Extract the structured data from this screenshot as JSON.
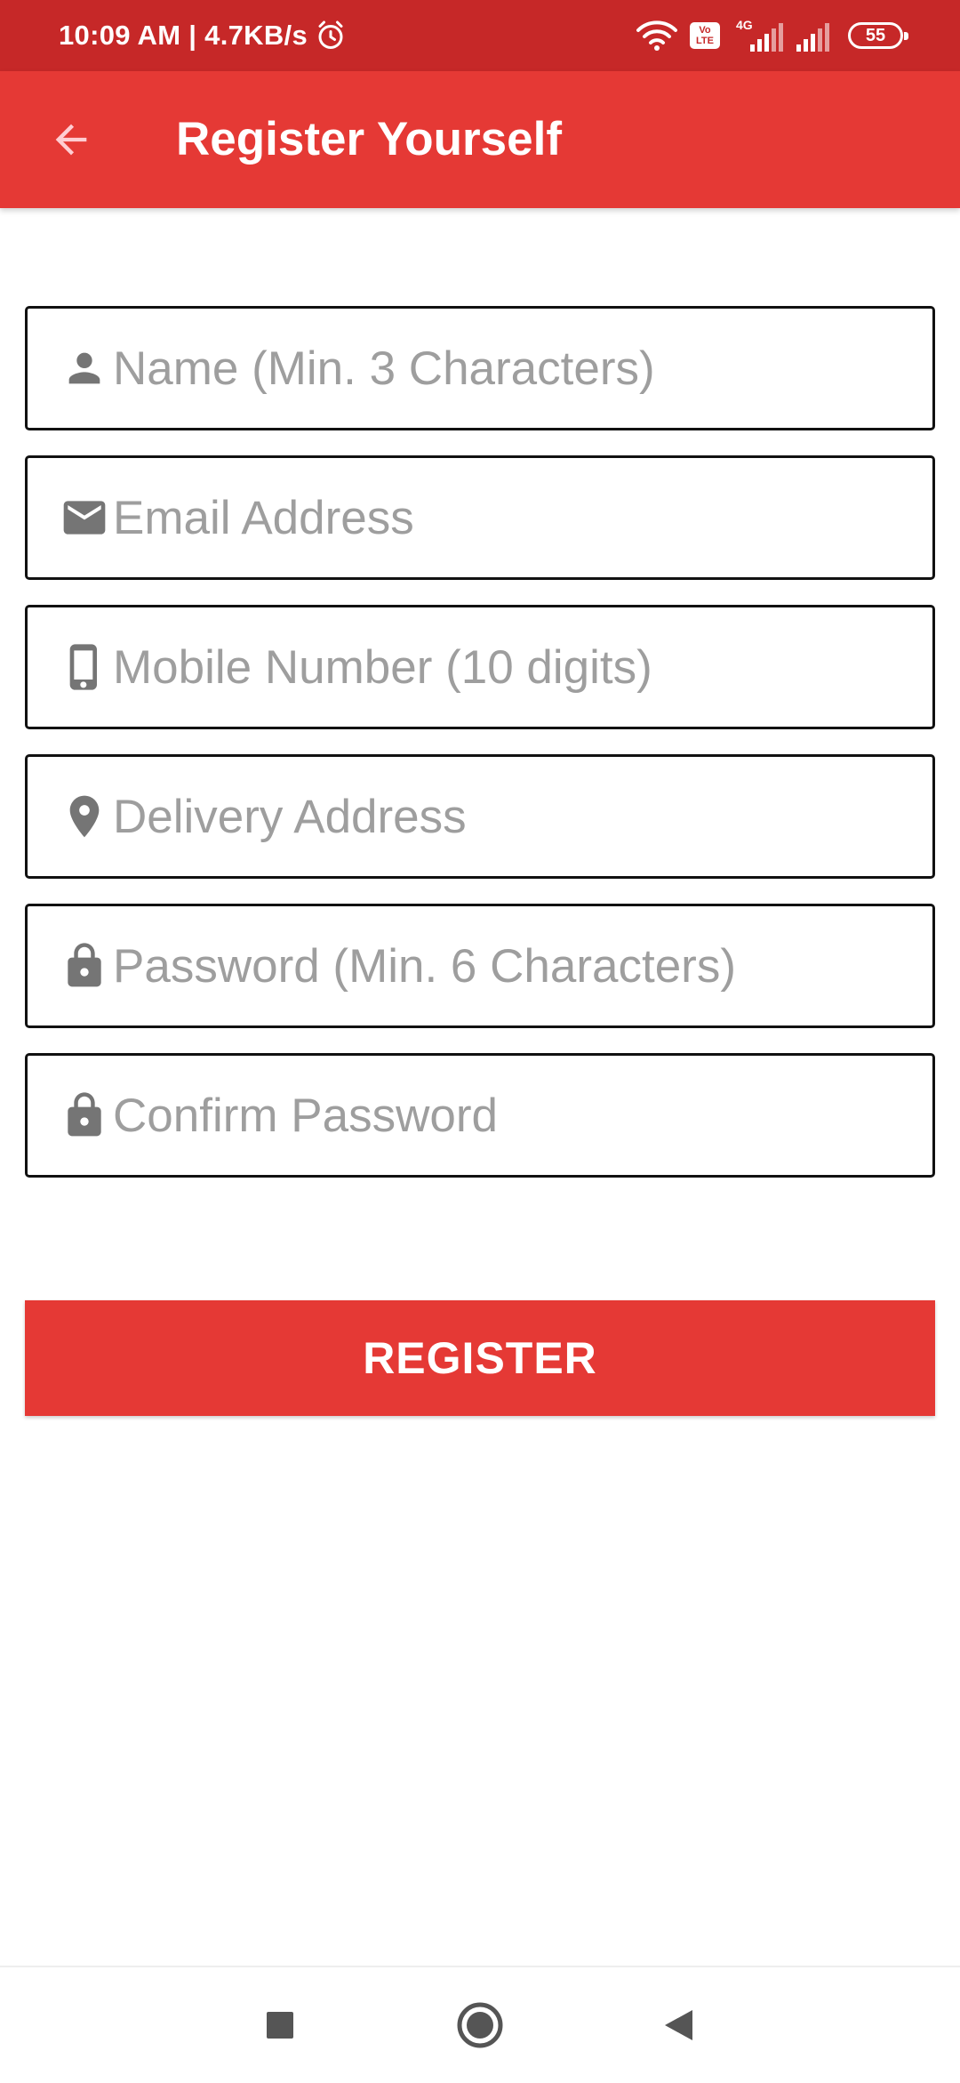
{
  "status_bar": {
    "time_speed": "10:09 AM | 4.7KB/s",
    "volte_line1": "Vo",
    "volte_line2": "LTE",
    "network_type": "4G",
    "battery": "55"
  },
  "app_bar": {
    "title": "Register Yourself",
    "background_color": "#e53935"
  },
  "form": {
    "fields": [
      {
        "icon": "person-icon",
        "placeholder": "Name (Min. 3 Characters)",
        "value": ""
      },
      {
        "icon": "email-icon",
        "placeholder": "Email Address",
        "value": ""
      },
      {
        "icon": "phone-icon",
        "placeholder": "Mobile Number (10 digits)",
        "value": ""
      },
      {
        "icon": "location-pin-icon",
        "placeholder": "Delivery Address",
        "value": ""
      },
      {
        "icon": "lock-icon",
        "placeholder": "Password (Min. 6 Characters)",
        "value": ""
      },
      {
        "icon": "lock-icon",
        "placeholder": "Confirm Password",
        "value": ""
      }
    ],
    "register_label": "REGISTER"
  },
  "colors": {
    "status_bar": "#c62828",
    "accent": "#e53935",
    "placeholder": "#9e9e9e",
    "icon": "#757575"
  }
}
